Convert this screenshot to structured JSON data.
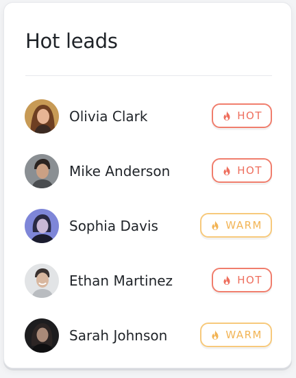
{
  "card": {
    "title": "Hot leads"
  },
  "leads": [
    {
      "name": "Olivia Clark",
      "status": "HOT",
      "tone": "hot"
    },
    {
      "name": "Mike Anderson",
      "status": "HOT",
      "tone": "hot"
    },
    {
      "name": "Sophia Davis",
      "status": "WARM",
      "tone": "warm"
    },
    {
      "name": "Ethan Martinez",
      "status": "HOT",
      "tone": "hot"
    },
    {
      "name": "Sarah Johnson",
      "status": "WARM",
      "tone": "warm"
    }
  ],
  "icons": {
    "badge": "flame-icon"
  },
  "colors": {
    "hot": "#ee6e5d",
    "hot_border": "#f07d6c",
    "warm": "#f2b455",
    "warm_border": "#f7c97b"
  }
}
